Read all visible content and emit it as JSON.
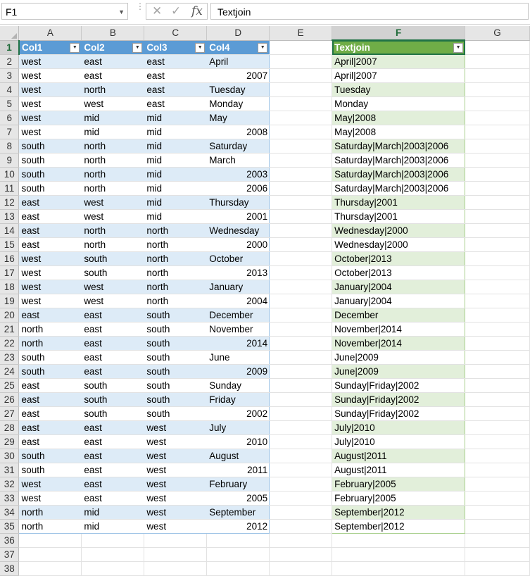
{
  "name_box": "F1",
  "formula": "Textjoin",
  "columns": [
    "A",
    "B",
    "C",
    "D",
    "E",
    "F",
    "G"
  ],
  "headers": [
    "Col1",
    "Col2",
    "Col3",
    "Col4"
  ],
  "result_header": "Textjoin",
  "rows": [
    [
      "west",
      "east",
      "east",
      "April",
      "April|2007"
    ],
    [
      "west",
      "east",
      "east",
      "2007",
      "April|2007"
    ],
    [
      "west",
      "north",
      "east",
      "Tuesday",
      "Tuesday"
    ],
    [
      "west",
      "west",
      "east",
      "Monday",
      "Monday"
    ],
    [
      "west",
      "mid",
      "mid",
      "May",
      "May|2008"
    ],
    [
      "west",
      "mid",
      "mid",
      "2008",
      "May|2008"
    ],
    [
      "south",
      "north",
      "mid",
      "Saturday",
      "Saturday|March|2003|2006"
    ],
    [
      "south",
      "north",
      "mid",
      "March",
      "Saturday|March|2003|2006"
    ],
    [
      "south",
      "north",
      "mid",
      "2003",
      "Saturday|March|2003|2006"
    ],
    [
      "south",
      "north",
      "mid",
      "2006",
      "Saturday|March|2003|2006"
    ],
    [
      "east",
      "west",
      "mid",
      "Thursday",
      "Thursday|2001"
    ],
    [
      "east",
      "west",
      "mid",
      "2001",
      "Thursday|2001"
    ],
    [
      "east",
      "north",
      "north",
      "Wednesday",
      "Wednesday|2000"
    ],
    [
      "east",
      "north",
      "north",
      "2000",
      "Wednesday|2000"
    ],
    [
      "west",
      "south",
      "north",
      "October",
      "October|2013"
    ],
    [
      "west",
      "south",
      "north",
      "2013",
      "October|2013"
    ],
    [
      "west",
      "west",
      "north",
      "January",
      "January|2004"
    ],
    [
      "west",
      "west",
      "north",
      "2004",
      "January|2004"
    ],
    [
      "east",
      "east",
      "south",
      "December",
      "December"
    ],
    [
      "north",
      "east",
      "south",
      "November",
      "November|2014"
    ],
    [
      "north",
      "east",
      "south",
      "2014",
      "November|2014"
    ],
    [
      "south",
      "east",
      "south",
      "June",
      "June|2009"
    ],
    [
      "south",
      "east",
      "south",
      "2009",
      "June|2009"
    ],
    [
      "east",
      "south",
      "south",
      "Sunday",
      "Sunday|Friday|2002"
    ],
    [
      "east",
      "south",
      "south",
      "Friday",
      "Sunday|Friday|2002"
    ],
    [
      "east",
      "south",
      "south",
      "2002",
      "Sunday|Friday|2002"
    ],
    [
      "east",
      "east",
      "west",
      "July",
      "July|2010"
    ],
    [
      "east",
      "east",
      "west",
      "2010",
      "July|2010"
    ],
    [
      "south",
      "east",
      "west",
      "August",
      "August|2011"
    ],
    [
      "south",
      "east",
      "west",
      "2011",
      "August|2011"
    ],
    [
      "west",
      "east",
      "west",
      "February",
      "February|2005"
    ],
    [
      "west",
      "east",
      "west",
      "2005",
      "February|2005"
    ],
    [
      "north",
      "mid",
      "west",
      "September",
      "September|2012"
    ],
    [
      "north",
      "mid",
      "west",
      "2012",
      "September|2012"
    ]
  ],
  "total_rows": 38,
  "colors": {
    "table_header_blue": "#5b9bd5",
    "band_blue": "#ddebf7",
    "table_header_green": "#70ad47",
    "band_green": "#e2efda",
    "selection": "#217346"
  }
}
